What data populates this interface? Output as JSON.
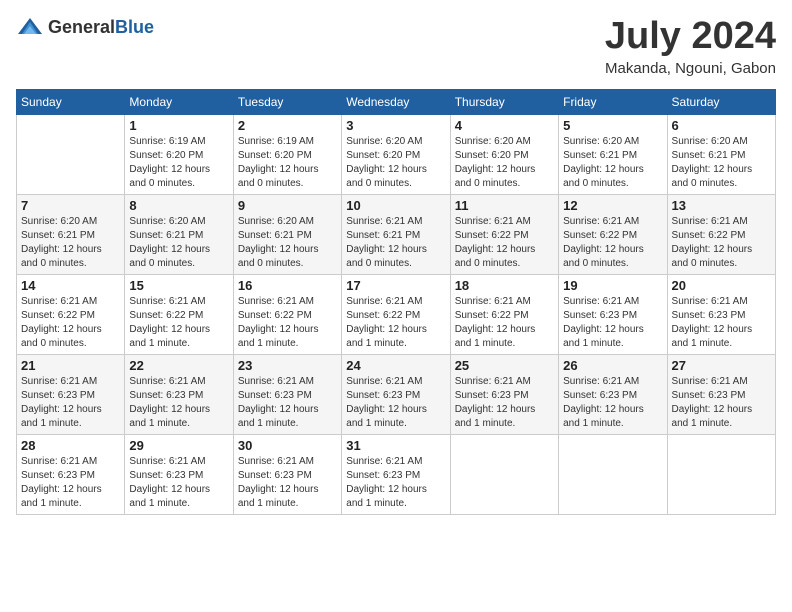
{
  "header": {
    "logo_general": "General",
    "logo_blue": "Blue",
    "month_year": "July 2024",
    "location": "Makanda, Ngouni, Gabon"
  },
  "days_of_week": [
    "Sunday",
    "Monday",
    "Tuesday",
    "Wednesday",
    "Thursday",
    "Friday",
    "Saturday"
  ],
  "weeks": [
    [
      {
        "day": "",
        "sunrise": "",
        "sunset": "",
        "daylight": ""
      },
      {
        "day": "1",
        "sunrise": "Sunrise: 6:19 AM",
        "sunset": "Sunset: 6:20 PM",
        "daylight": "Daylight: 12 hours and 0 minutes."
      },
      {
        "day": "2",
        "sunrise": "Sunrise: 6:19 AM",
        "sunset": "Sunset: 6:20 PM",
        "daylight": "Daylight: 12 hours and 0 minutes."
      },
      {
        "day": "3",
        "sunrise": "Sunrise: 6:20 AM",
        "sunset": "Sunset: 6:20 PM",
        "daylight": "Daylight: 12 hours and 0 minutes."
      },
      {
        "day": "4",
        "sunrise": "Sunrise: 6:20 AM",
        "sunset": "Sunset: 6:20 PM",
        "daylight": "Daylight: 12 hours and 0 minutes."
      },
      {
        "day": "5",
        "sunrise": "Sunrise: 6:20 AM",
        "sunset": "Sunset: 6:21 PM",
        "daylight": "Daylight: 12 hours and 0 minutes."
      },
      {
        "day": "6",
        "sunrise": "Sunrise: 6:20 AM",
        "sunset": "Sunset: 6:21 PM",
        "daylight": "Daylight: 12 hours and 0 minutes."
      }
    ],
    [
      {
        "day": "7",
        "sunrise": "Sunrise: 6:20 AM",
        "sunset": "Sunset: 6:21 PM",
        "daylight": "Daylight: 12 hours and 0 minutes."
      },
      {
        "day": "8",
        "sunrise": "Sunrise: 6:20 AM",
        "sunset": "Sunset: 6:21 PM",
        "daylight": "Daylight: 12 hours and 0 minutes."
      },
      {
        "day": "9",
        "sunrise": "Sunrise: 6:20 AM",
        "sunset": "Sunset: 6:21 PM",
        "daylight": "Daylight: 12 hours and 0 minutes."
      },
      {
        "day": "10",
        "sunrise": "Sunrise: 6:21 AM",
        "sunset": "Sunset: 6:21 PM",
        "daylight": "Daylight: 12 hours and 0 minutes."
      },
      {
        "day": "11",
        "sunrise": "Sunrise: 6:21 AM",
        "sunset": "Sunset: 6:22 PM",
        "daylight": "Daylight: 12 hours and 0 minutes."
      },
      {
        "day": "12",
        "sunrise": "Sunrise: 6:21 AM",
        "sunset": "Sunset: 6:22 PM",
        "daylight": "Daylight: 12 hours and 0 minutes."
      },
      {
        "day": "13",
        "sunrise": "Sunrise: 6:21 AM",
        "sunset": "Sunset: 6:22 PM",
        "daylight": "Daylight: 12 hours and 0 minutes."
      }
    ],
    [
      {
        "day": "14",
        "sunrise": "Sunrise: 6:21 AM",
        "sunset": "Sunset: 6:22 PM",
        "daylight": "Daylight: 12 hours and 0 minutes."
      },
      {
        "day": "15",
        "sunrise": "Sunrise: 6:21 AM",
        "sunset": "Sunset: 6:22 PM",
        "daylight": "Daylight: 12 hours and 1 minute."
      },
      {
        "day": "16",
        "sunrise": "Sunrise: 6:21 AM",
        "sunset": "Sunset: 6:22 PM",
        "daylight": "Daylight: 12 hours and 1 minute."
      },
      {
        "day": "17",
        "sunrise": "Sunrise: 6:21 AM",
        "sunset": "Sunset: 6:22 PM",
        "daylight": "Daylight: 12 hours and 1 minute."
      },
      {
        "day": "18",
        "sunrise": "Sunrise: 6:21 AM",
        "sunset": "Sunset: 6:22 PM",
        "daylight": "Daylight: 12 hours and 1 minute."
      },
      {
        "day": "19",
        "sunrise": "Sunrise: 6:21 AM",
        "sunset": "Sunset: 6:23 PM",
        "daylight": "Daylight: 12 hours and 1 minute."
      },
      {
        "day": "20",
        "sunrise": "Sunrise: 6:21 AM",
        "sunset": "Sunset: 6:23 PM",
        "daylight": "Daylight: 12 hours and 1 minute."
      }
    ],
    [
      {
        "day": "21",
        "sunrise": "Sunrise: 6:21 AM",
        "sunset": "Sunset: 6:23 PM",
        "daylight": "Daylight: 12 hours and 1 minute."
      },
      {
        "day": "22",
        "sunrise": "Sunrise: 6:21 AM",
        "sunset": "Sunset: 6:23 PM",
        "daylight": "Daylight: 12 hours and 1 minute."
      },
      {
        "day": "23",
        "sunrise": "Sunrise: 6:21 AM",
        "sunset": "Sunset: 6:23 PM",
        "daylight": "Daylight: 12 hours and 1 minute."
      },
      {
        "day": "24",
        "sunrise": "Sunrise: 6:21 AM",
        "sunset": "Sunset: 6:23 PM",
        "daylight": "Daylight: 12 hours and 1 minute."
      },
      {
        "day": "25",
        "sunrise": "Sunrise: 6:21 AM",
        "sunset": "Sunset: 6:23 PM",
        "daylight": "Daylight: 12 hours and 1 minute."
      },
      {
        "day": "26",
        "sunrise": "Sunrise: 6:21 AM",
        "sunset": "Sunset: 6:23 PM",
        "daylight": "Daylight: 12 hours and 1 minute."
      },
      {
        "day": "27",
        "sunrise": "Sunrise: 6:21 AM",
        "sunset": "Sunset: 6:23 PM",
        "daylight": "Daylight: 12 hours and 1 minute."
      }
    ],
    [
      {
        "day": "28",
        "sunrise": "Sunrise: 6:21 AM",
        "sunset": "Sunset: 6:23 PM",
        "daylight": "Daylight: 12 hours and 1 minute."
      },
      {
        "day": "29",
        "sunrise": "Sunrise: 6:21 AM",
        "sunset": "Sunset: 6:23 PM",
        "daylight": "Daylight: 12 hours and 1 minute."
      },
      {
        "day": "30",
        "sunrise": "Sunrise: 6:21 AM",
        "sunset": "Sunset: 6:23 PM",
        "daylight": "Daylight: 12 hours and 1 minute."
      },
      {
        "day": "31",
        "sunrise": "Sunrise: 6:21 AM",
        "sunset": "Sunset: 6:23 PM",
        "daylight": "Daylight: 12 hours and 1 minute."
      },
      {
        "day": "",
        "sunrise": "",
        "sunset": "",
        "daylight": ""
      },
      {
        "day": "",
        "sunrise": "",
        "sunset": "",
        "daylight": ""
      },
      {
        "day": "",
        "sunrise": "",
        "sunset": "",
        "daylight": ""
      }
    ]
  ]
}
